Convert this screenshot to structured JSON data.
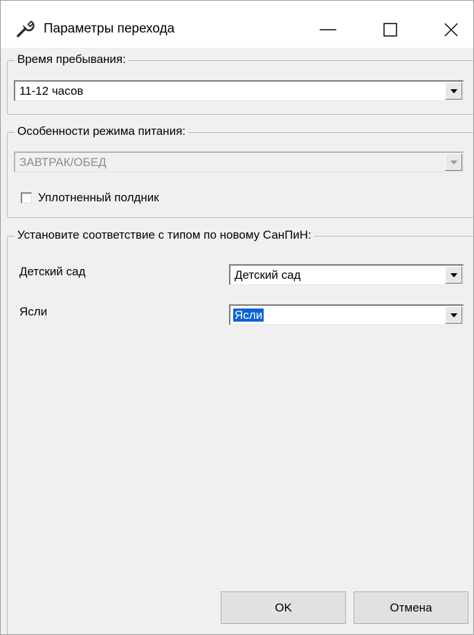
{
  "window": {
    "title": "Параметры перехода",
    "icon": "wrench-icon",
    "controls": [
      "minimize-icon",
      "maximize-icon",
      "close-icon"
    ]
  },
  "stay_group": {
    "legend": "Время пребывания:",
    "combo_value": "11-12 часов"
  },
  "meal_group": {
    "legend": "Особенности режима питания:",
    "combo_value": "ЗАВТРАК/ОБЕД",
    "combo_disabled": true,
    "checkbox_label": "Уплотненный полдник",
    "checkbox_checked": false
  },
  "sanpin_group": {
    "legend": "Установите соответствие с типом по новому СанПиН:",
    "rows": [
      {
        "label": "Детский сад",
        "value": "Детский сад"
      },
      {
        "label": "Ясли",
        "value": "Ясли",
        "selected": true
      }
    ]
  },
  "footer": {
    "ok_label": "OK",
    "cancel_label": "Отмена"
  },
  "colors": {
    "selection": "#0a64d8",
    "background": "#f0f0f0"
  }
}
